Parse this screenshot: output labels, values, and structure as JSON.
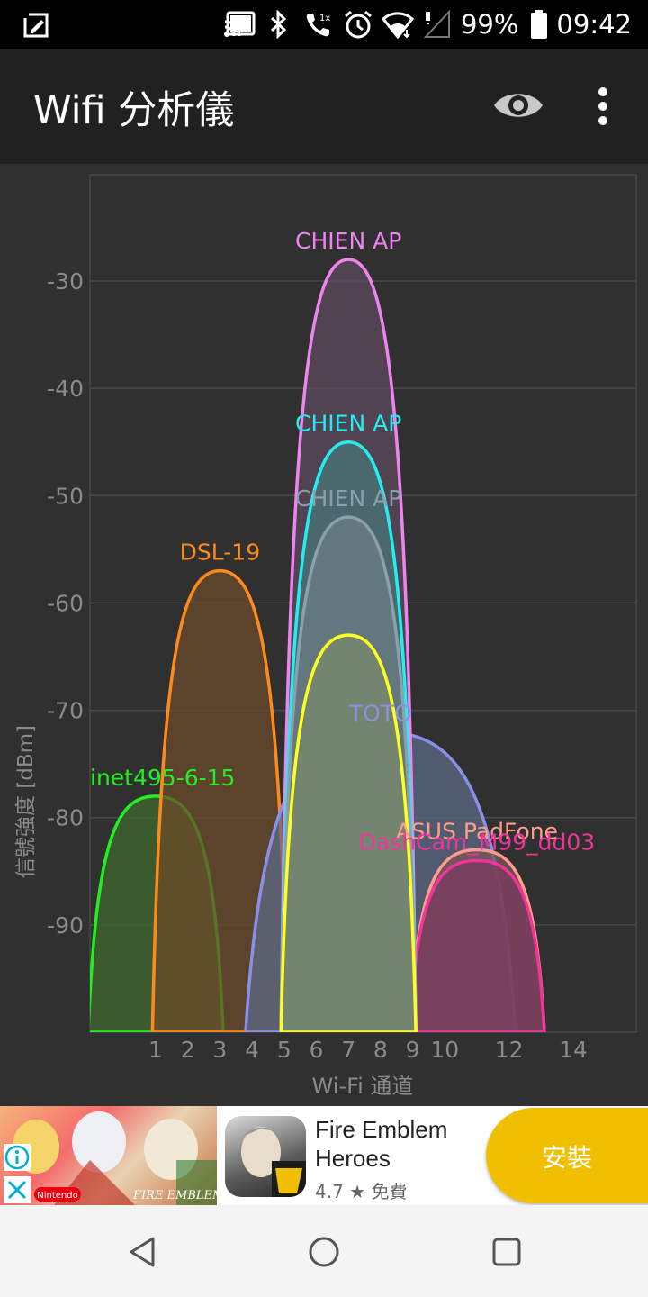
{
  "status_bar": {
    "battery": "99%",
    "time": "09:42",
    "icons": [
      "screenshot-edit-icon",
      "cast-icon",
      "bluetooth-icon",
      "wifi-call-icon",
      "alarm-icon",
      "wifi-icon",
      "cell-signal-icon",
      "battery-icon"
    ]
  },
  "app_bar": {
    "title": "Wifi 分析儀",
    "icons": [
      "eye-icon",
      "more-vert-icon"
    ]
  },
  "chart_data": {
    "type": "area",
    "xlabel": "Wi-Fi 通道",
    "ylabel": "信號強度 [dBm]",
    "ylim": [
      -100,
      -20
    ],
    "xlim": [
      -1,
      17.5
    ],
    "ytick_labels": [
      "-30",
      "-40",
      "-50",
      "-60",
      "-70",
      "-80",
      "-90"
    ],
    "xtick_labels": [
      "1",
      "2",
      "3",
      "4",
      "5",
      "6",
      "7",
      "8",
      "9",
      "10",
      "12",
      "14"
    ],
    "xtick_values": [
      1,
      2,
      3,
      4,
      5,
      6,
      7,
      8,
      9,
      10,
      12,
      14
    ],
    "series": [
      {
        "name": "inet495-6-15",
        "channel": 1,
        "width_channels": 4,
        "signal_dbm": -78,
        "color": "#22ee22",
        "fill": "#3f6a2e"
      },
      {
        "name": "DSL-19",
        "channel": 3,
        "width_channels": 4,
        "signal_dbm": -57,
        "color": "#ff8a1c",
        "fill": "#6b4a2a"
      },
      {
        "name": "TOTO",
        "channel": 8,
        "width_channels": 8,
        "signal_dbm": -72,
        "color": "#8a90e8",
        "fill": "#5c6a86"
      },
      {
        "name": "ASUS PadFone",
        "channel": 11,
        "width_channels": 4,
        "signal_dbm": -83,
        "color": "#ff9c8a",
        "fill": "#7a5458"
      },
      {
        "name": "DashCam_M99_dd03",
        "channel": 11,
        "width_channels": 4,
        "signal_dbm": -84,
        "color": "#f0359a",
        "fill": "#7a3a5e"
      },
      {
        "name": "CHIEN AP",
        "channel": 7,
        "width_channels": 4,
        "signal_dbm": -28,
        "color": "#ee84ee",
        "fill": "#5e4a5e"
      },
      {
        "name": "CHIEN AP",
        "channel": 7,
        "width_channels": 4,
        "signal_dbm": -45,
        "color": "#22eef0",
        "fill": "#4a7478"
      },
      {
        "name": "CHIEN AP",
        "channel": 7,
        "width_channels": 4,
        "signal_dbm": -52,
        "color": "#8aa0ac",
        "fill": "#6a7e84"
      },
      {
        "name": "",
        "channel": 7,
        "width_channels": 4,
        "signal_dbm": -63,
        "color": "#ffff22",
        "fill": "#7a8a6a"
      }
    ],
    "grid": true
  },
  "ad": {
    "app_name": "Fire Emblem Heroes",
    "rating": "4.7 ★ 免費",
    "install_label": "安裝",
    "banner_text": "FIRE EMBLEM Heroes",
    "banner_badge": "Nintendo"
  },
  "nav_bar": {
    "buttons": [
      "back-icon",
      "home-icon",
      "recents-icon"
    ]
  }
}
